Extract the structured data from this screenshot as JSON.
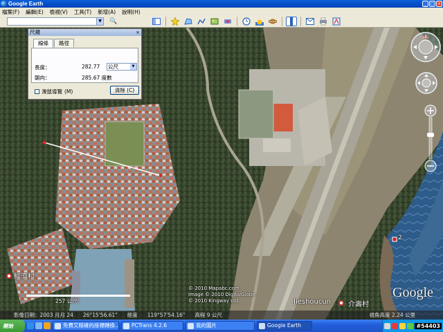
{
  "window": {
    "title": "Google Earth"
  },
  "menu": [
    "檔案(F)",
    "編輯(E)",
    "檢視(V)",
    "工具(T)",
    "新增(A)",
    "說明(H)"
  ],
  "toolbar": {
    "search_value": "",
    "icons": [
      "hide-sidebar-icon",
      "placemark-icon",
      "polygon-icon",
      "path-icon",
      "image-overlay-icon",
      "record-tour-icon",
      "historical-imagery-icon",
      "sunlight-icon",
      "planets-icon",
      "ruler-icon",
      "email-icon",
      "print-icon",
      "view-in-maps-icon"
    ]
  },
  "ruler": {
    "title": "尺規",
    "tabs": [
      "線條",
      "路徑"
    ],
    "length_label": "長度：",
    "length_value": "282.77",
    "unit": "公尺",
    "heading_label": "朝向：",
    "heading_value": "285.67 度數",
    "mouse_nav_label": "滑鼠導覽",
    "mouse_nav_key": "(M)",
    "clear_label": "清除",
    "clear_key": "(C)"
  },
  "map": {
    "copyright": [
      "© 2010 Mapabc.com",
      "Image © 2010 DigitalGlobe",
      "© 2010 Kingway Ltd."
    ],
    "scale_label": "257 公尺",
    "places": [
      {
        "name": "經濟村",
        "id": "west-village"
      },
      {
        "name": "Jieshoucun",
        "id": "jieshoucun"
      },
      {
        "name": "介壽村",
        "id": "jieshou-village"
      }
    ],
    "marker_label": "2",
    "logo": "Google"
  },
  "status": {
    "date": "影像日期：2003 月月 24",
    "lat": "26°15'56.61\"",
    "lon_label": "經度",
    "lon": "119°57'54.16\"",
    "elevation": "高程 9 公尺",
    "stream": "視角高度 2.24 公里"
  },
  "taskbar": {
    "start": "開始",
    "tasks": [
      {
        "label": "免費又精確的座標轉換...",
        "active": false
      },
      {
        "label": "PCTrans 4.2.6",
        "active": false
      },
      {
        "label": "我的圖片",
        "active": false
      },
      {
        "label": "Google Earth",
        "active": true
      }
    ],
    "counter": "#54403"
  }
}
